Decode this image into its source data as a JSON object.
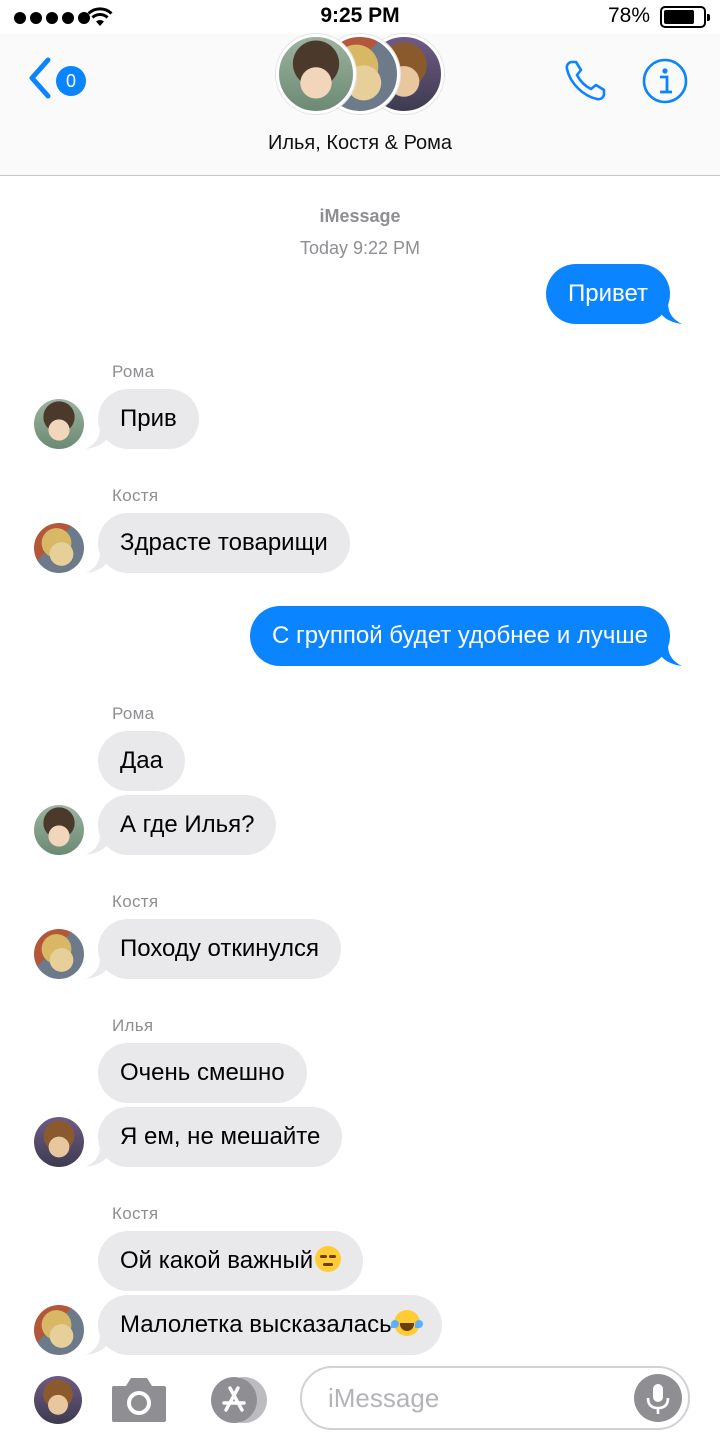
{
  "status_bar": {
    "time": "9:25 PM",
    "battery_percent": "78%",
    "battery_level": 0.78
  },
  "header": {
    "back_badge": "0",
    "title": "Илья, Костя & Рома",
    "icons": [
      "chevron-left-icon",
      "phone-icon",
      "info-icon"
    ]
  },
  "chat": {
    "service": "iMessage",
    "timestamp": "Today 9:22 PM",
    "messages": [
      {
        "direction": "out",
        "text": "Привет"
      },
      {
        "direction": "in",
        "sender": "Рома",
        "text": "Прив"
      },
      {
        "direction": "in",
        "sender": "Костя",
        "text": "Здрасте товарищи"
      },
      {
        "direction": "out",
        "text": "С группой будет удобнее и лучше"
      },
      {
        "direction": "in",
        "sender": "Рома",
        "text": "Даа"
      },
      {
        "direction": "in",
        "text": "А где Илья?"
      },
      {
        "direction": "in",
        "sender": "Костя",
        "text": "Походу откинулся"
      },
      {
        "direction": "in",
        "sender": "Илья",
        "text": "Очень смешно"
      },
      {
        "direction": "in",
        "text": "Я ем, не мешайте"
      },
      {
        "direction": "in",
        "sender": "Костя",
        "text": "Ой какой важный",
        "emoji": "smirk-emoji"
      },
      {
        "direction": "in",
        "text": "Малолетка высказалась",
        "emoji": "laughing-tears-emoji"
      }
    ]
  },
  "input": {
    "placeholder": "iMessage"
  },
  "colors": {
    "accent": "#0b84ff",
    "incoming_bubble": "#e9e9eb",
    "secondary_text": "#8e8e93"
  }
}
